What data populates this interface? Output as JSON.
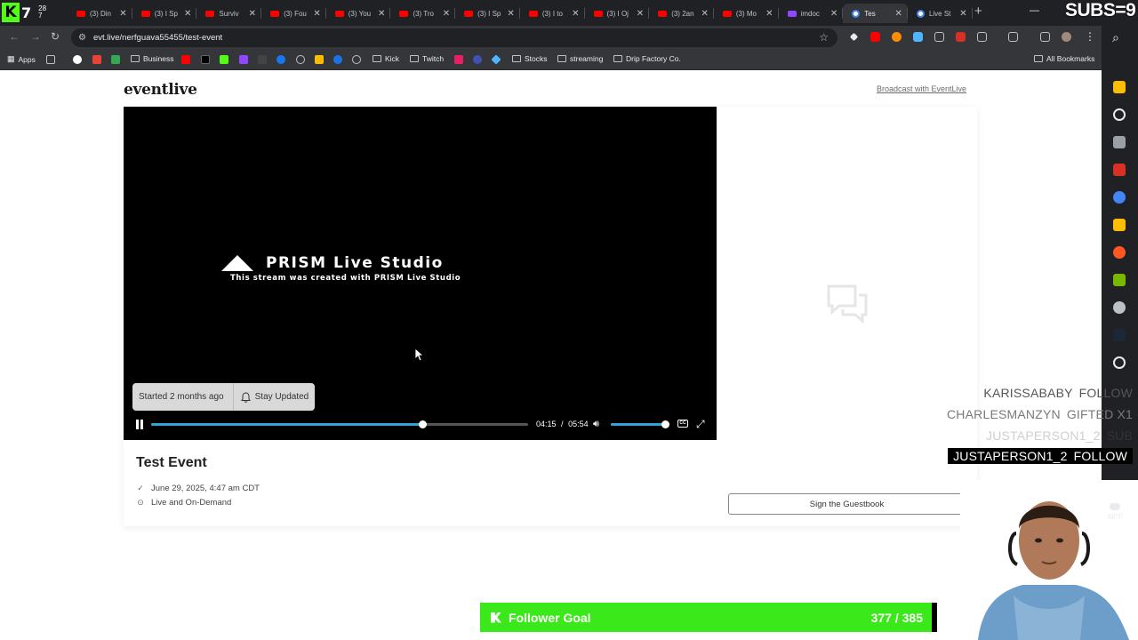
{
  "stream_badge": {
    "k": "K",
    "count": "7",
    "small_top": "28",
    "small_bottom": "7"
  },
  "tabs": [
    {
      "label": "(3) Din",
      "fav": "yt"
    },
    {
      "label": "(3) I Sp",
      "fav": "yt"
    },
    {
      "label": "Surviv",
      "fav": "yt"
    },
    {
      "label": "(3) Fou",
      "fav": "yt"
    },
    {
      "label": "(3) You",
      "fav": "yt"
    },
    {
      "label": "(3) Tro",
      "fav": "yt"
    },
    {
      "label": "(3) I Sp",
      "fav": "yt"
    },
    {
      "label": "(3) I to",
      "fav": "yt"
    },
    {
      "label": "(3) I Oj",
      "fav": "yt"
    },
    {
      "label": "(3) 2an",
      "fav": "yt"
    },
    {
      "label": "(3) Mo",
      "fav": "yt"
    },
    {
      "label": "imdoc",
      "fav": "tw"
    },
    {
      "label": "Tes",
      "fav": "gl",
      "active": true
    },
    {
      "label": "Live St",
      "fav": "gl"
    }
  ],
  "subs_overlay": "SUBS=9",
  "address": {
    "url": "evt.live/nerfguava55455/test-event"
  },
  "bookmarks": {
    "apps": "Apps",
    "business": "Business",
    "kick": "Kick",
    "twitch": "Twitch",
    "stocks": "Stocks",
    "streaming": "streaming",
    "drip": "Drip Factory Co.",
    "all": "All Bookmarks"
  },
  "page": {
    "logo": "eventlive",
    "broadcast_link": "Broadcast with EventLive",
    "video": {
      "prism_title": "PRISM Live Studio",
      "prism_sub": "This stream was created with PRISM Live Studio",
      "started": "Started 2 months ago",
      "stay_updated": "Stay Updated",
      "current_time": "04:15",
      "separator": "/",
      "duration": "05:54",
      "progress": 0.72,
      "volume": 0.95
    },
    "event": {
      "title": "Test Event",
      "date": "June 29, 2025, 4:47 am CDT",
      "location": "Live and On-Demand",
      "guestbook": "Sign the Guestbook"
    }
  },
  "overlays": {
    "alerts": [
      {
        "name": "KARISSABABY",
        "action": "FOLLOW"
      },
      {
        "name": "CHARLESMANZYN",
        "action": "GIFTED X1"
      },
      {
        "name": "JUSTAPERSON1_2",
        "action": "SUB"
      },
      {
        "name": "JUSTAPERSON1_2",
        "action": "FOLLOW"
      }
    ],
    "follower_goal": {
      "label": "Follower Goal",
      "count": "377 / 385"
    },
    "weather": "68°F"
  },
  "colors": {
    "accent": "#2aa7d8",
    "goal": "#3be81a",
    "kick": "#53fc18"
  }
}
